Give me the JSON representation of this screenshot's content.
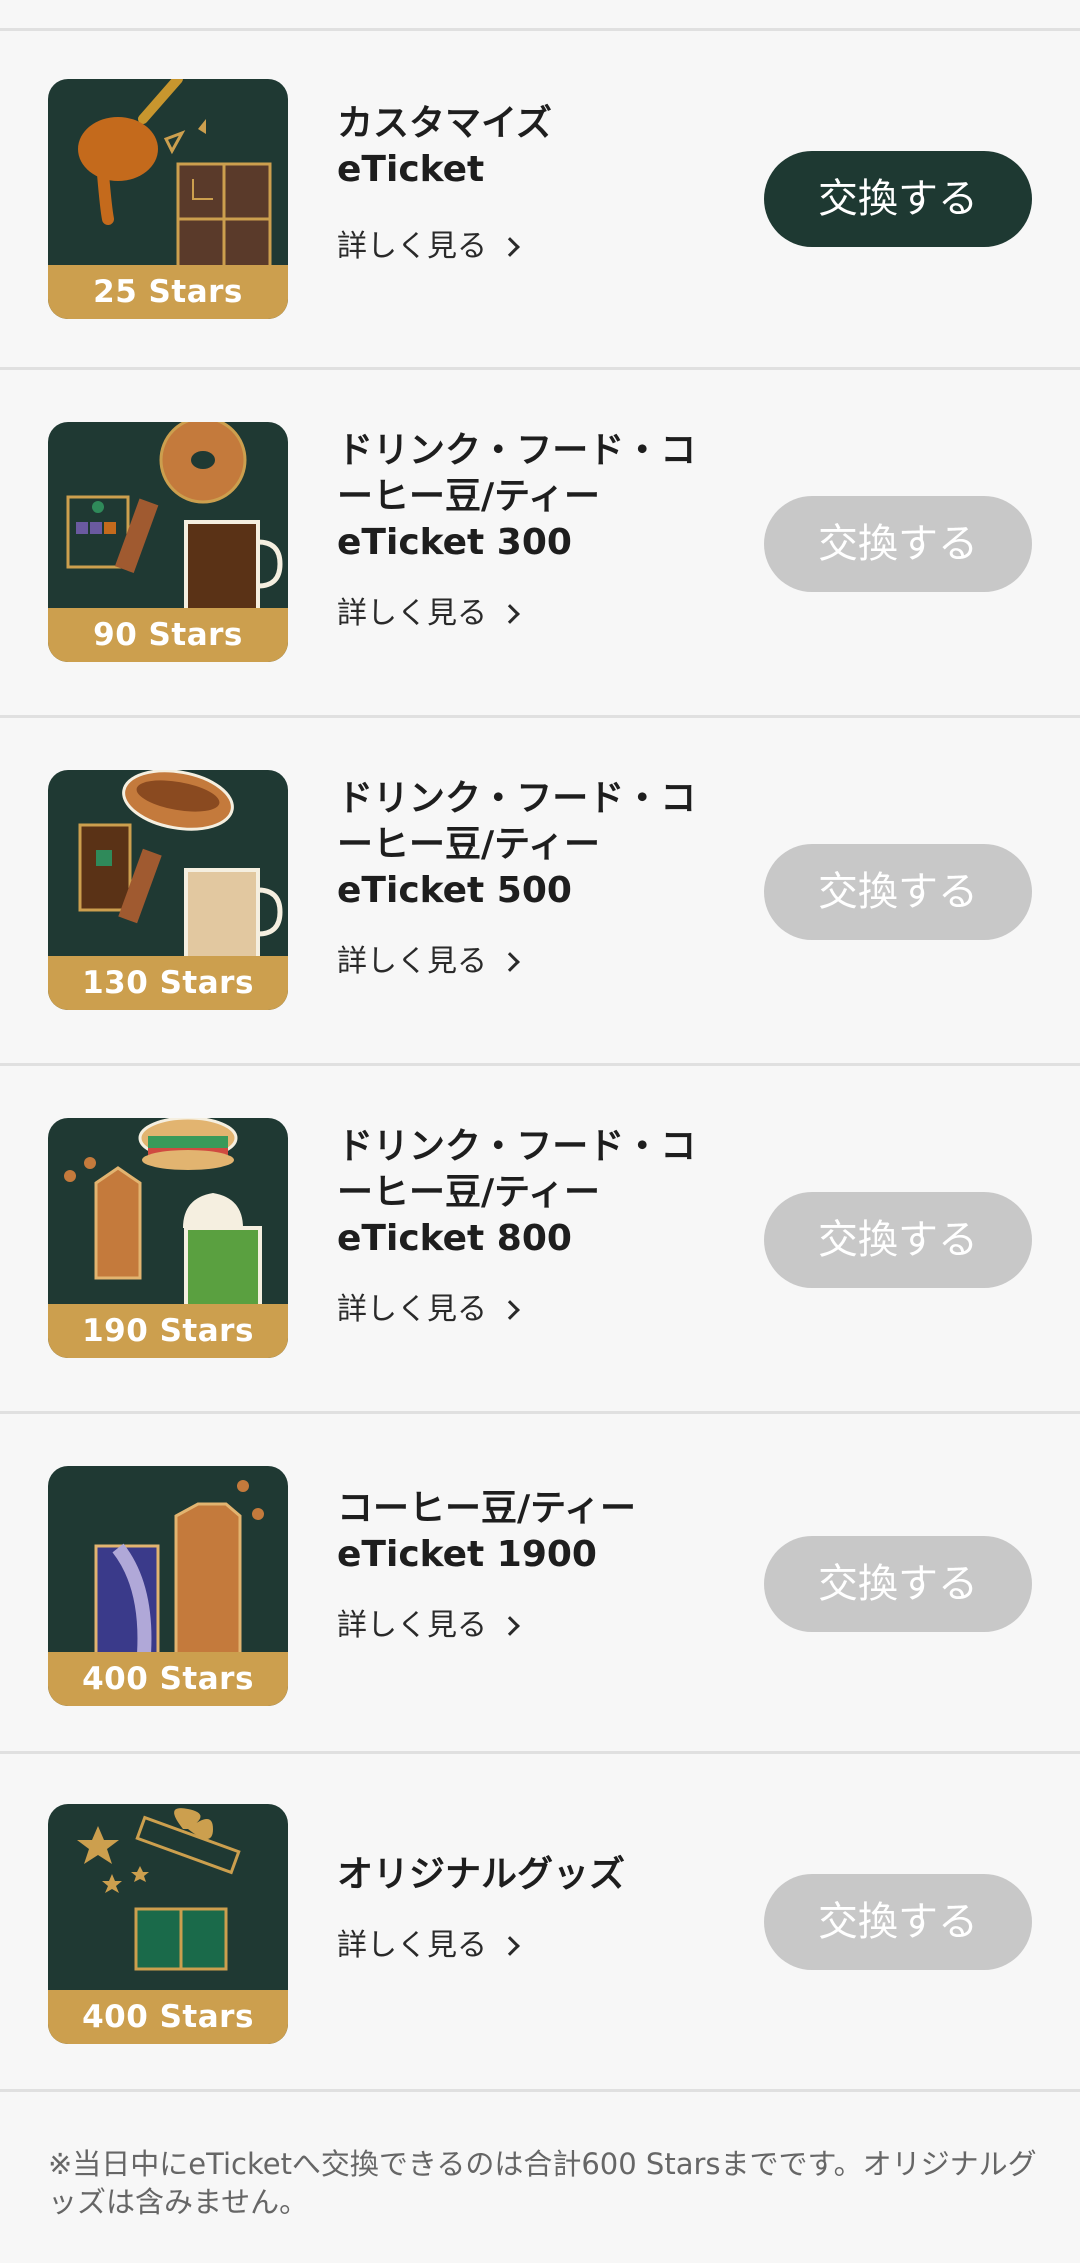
{
  "rewards": [
    {
      "title_lines": [
        "カスタマイズ",
        "eTicket"
      ],
      "stars": "25 Stars",
      "detail": "詳しく見る",
      "button": "交換する",
      "enabled": true,
      "icon": "customize-eticket-icon"
    },
    {
      "title_lines": [
        "ドリンク・フード・コ",
        "ーヒー豆/ティー",
        "eTicket 300"
      ],
      "stars": "90 Stars",
      "detail": "詳しく見る",
      "button": "交換する",
      "enabled": false,
      "icon": "drink-food-300-icon"
    },
    {
      "title_lines": [
        "ドリンク・フード・コ",
        "ーヒー豆/ティー",
        "eTicket 500"
      ],
      "stars": "130 Stars",
      "detail": "詳しく見る",
      "button": "交換する",
      "enabled": false,
      "icon": "drink-food-500-icon"
    },
    {
      "title_lines": [
        "ドリンク・フード・コ",
        "ーヒー豆/ティー",
        "eTicket 800"
      ],
      "stars": "190 Stars",
      "detail": "詳しく見る",
      "button": "交換する",
      "enabled": false,
      "icon": "drink-food-800-icon"
    },
    {
      "title_lines": [
        "コーヒー豆/ティー",
        "eTicket 1900"
      ],
      "stars": "400 Stars",
      "detail": "詳しく見る",
      "button": "交換する",
      "enabled": false,
      "icon": "coffee-tea-1900-icon"
    },
    {
      "title_lines": [
        "オリジナルグッズ"
      ],
      "stars": "400 Stars",
      "detail": "詳しく見る",
      "button": "交換する",
      "enabled": false,
      "icon": "original-goods-icon"
    }
  ],
  "footnote": "※当日中にeTicketへ交換できるのは合計600 Starsまでです。オリジナルグッズは含みません。",
  "colors": {
    "background": "#f7f7f7",
    "thumb_bg": "#1f3933",
    "stars_band": "#cc9f4e",
    "button_active": "#1e3932",
    "button_disabled": "#c8c8c8"
  }
}
